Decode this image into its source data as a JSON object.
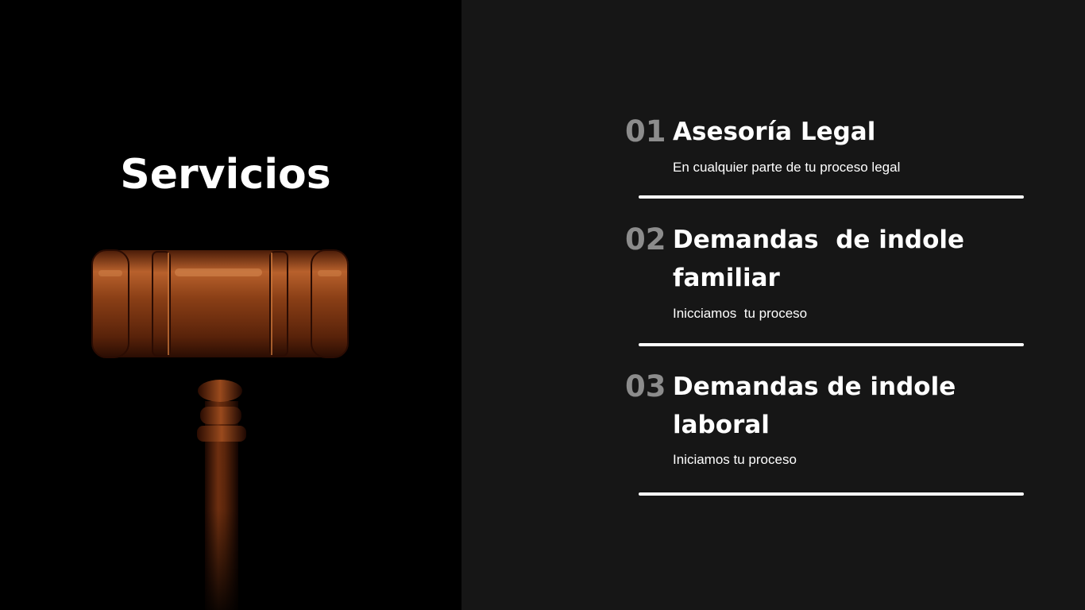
{
  "slide": {
    "title": "Servicios",
    "image_icon": "gavel-icon"
  },
  "services": [
    {
      "number": "01",
      "title": "Asesoría Legal",
      "description": "En cualquier parte de tu proceso legal"
    },
    {
      "number": "02",
      "title": "Demandas  de indole familiar",
      "description": "Inicciamos  tu proceso"
    },
    {
      "number": "03",
      "title": "Demandas de indole laboral",
      "description": "Iniciamos tu proceso"
    }
  ],
  "colors": {
    "left_background": "#000000",
    "right_background": "#161616",
    "number_color": "#8c8c8c",
    "text_color": "#ffffff",
    "divider_color": "#ffffff"
  }
}
